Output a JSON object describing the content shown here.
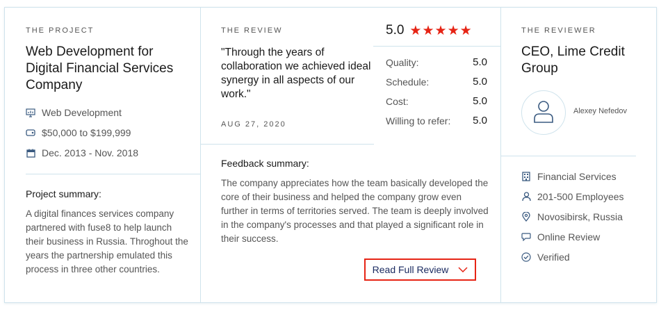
{
  "project": {
    "eyebrow": "THE PROJECT",
    "title": "Web Development for Digital Financial Services Company",
    "meta": [
      {
        "icon": "monitor-icon",
        "text": "Web Development"
      },
      {
        "icon": "price-tag-icon",
        "text": "$50,000 to $199,999"
      },
      {
        "icon": "calendar-icon",
        "text": "Dec. 2013 - Nov. 2018"
      }
    ],
    "summary_heading": "Project summary:",
    "summary_text": "A digital finances services company partnered with fuse8 to help launch their business in Russia. Throghout the years the partnership emulated this process in three other countries."
  },
  "review": {
    "eyebrow": "THE REVIEW",
    "quote": "\"Through the years of collaboration we achieved ideal synergy in all aspects of our work.\"",
    "date": "AUG 27, 2020",
    "overall_rating": "5.0",
    "stars": 5,
    "ratings": [
      {
        "label": "Quality:",
        "value": "5.0"
      },
      {
        "label": "Schedule:",
        "value": "5.0"
      },
      {
        "label": "Cost:",
        "value": "5.0"
      },
      {
        "label": "Willing to refer:",
        "value": "5.0"
      }
    ],
    "feedback_heading": "Feedback summary:",
    "feedback_text": "The company appreciates how the team basically developed the core of their business and helped the company grow even further in terms of territories served. The team is deeply involved in the company's processes and that played a significant role in their success.",
    "button_label": "Read Full Review"
  },
  "reviewer": {
    "eyebrow": "THE REVIEWER",
    "title": "CEO, Lime Credit Group",
    "name": "Alexey Nefedov",
    "details": [
      {
        "icon": "building-icon",
        "text": "Financial Services"
      },
      {
        "icon": "user-icon",
        "text": "201-500 Employees"
      },
      {
        "icon": "location-pin-icon",
        "text": "Novosibirsk, Russia"
      },
      {
        "icon": "chat-bubble-icon",
        "text": "Online Review"
      },
      {
        "icon": "check-circle-icon",
        "text": "Verified"
      }
    ]
  },
  "colors": {
    "accent": "#e62415",
    "border": "#cfe3ec",
    "icon": "#3a5a80",
    "button_text": "#1a2a60"
  }
}
